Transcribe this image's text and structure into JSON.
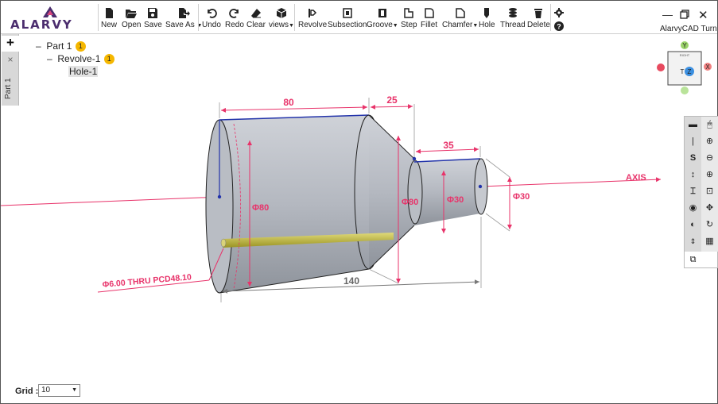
{
  "app": {
    "brand": "ALARVY",
    "title": "AlarvyCAD Turn"
  },
  "toolbar": {
    "file": [
      {
        "label": "New",
        "icon": "file-icon"
      },
      {
        "label": "Open",
        "icon": "folder-open-icon"
      },
      {
        "label": "Save",
        "icon": "save-icon"
      },
      {
        "label": "Save As",
        "icon": "file-export-icon"
      }
    ],
    "edit": [
      {
        "label": "Undo",
        "icon": "undo-icon"
      },
      {
        "label": "Redo",
        "icon": "redo-icon"
      },
      {
        "label": "Clear",
        "icon": "eraser-icon"
      },
      {
        "label": "views",
        "icon": "cube-icon"
      }
    ],
    "ops": [
      {
        "label": "Revolve",
        "icon": "revolve-icon"
      },
      {
        "label": "Subsection",
        "icon": "subsection-icon"
      },
      {
        "label": "Groove",
        "icon": "groove-icon"
      },
      {
        "label": "Step",
        "icon": "step-icon"
      },
      {
        "label": "Fillet",
        "icon": "fillet-icon"
      },
      {
        "label": "Chamfer",
        "icon": "chamfer-icon"
      },
      {
        "label": "Hole",
        "icon": "hole-icon"
      },
      {
        "label": "Thread",
        "icon": "thread-icon"
      },
      {
        "label": "Delete",
        "icon": "trash-icon"
      }
    ]
  },
  "tree": {
    "part": {
      "label": "Part 1",
      "badge": "1"
    },
    "revolve": {
      "label": "Revolve-1",
      "badge": "1"
    },
    "hole": {
      "label": "Hole-1"
    }
  },
  "sidetab": {
    "add": "+",
    "close": "×",
    "tab_label": "Part 1"
  },
  "viewcube": {
    "y": "Y",
    "x": "X",
    "z": "Z",
    "t": "T",
    "face": "RIGHT"
  },
  "dimensions": {
    "d80_len": "80",
    "d25_len": "25",
    "d35_len": "35",
    "d140_len": "140",
    "dia80a": "Φ80",
    "dia80b": "Φ80",
    "dia30a": "Φ30",
    "dia30b": "Φ30",
    "axis": "AXIS",
    "hole_note": "Φ6.00 THRU PCD48.10"
  },
  "grid": {
    "label": "Grid :",
    "value": "10"
  },
  "colors": {
    "accent": "#e8336a",
    "body": "#b3b8c0",
    "hole": "#c9c24a",
    "brand": "#4b2d6e"
  }
}
